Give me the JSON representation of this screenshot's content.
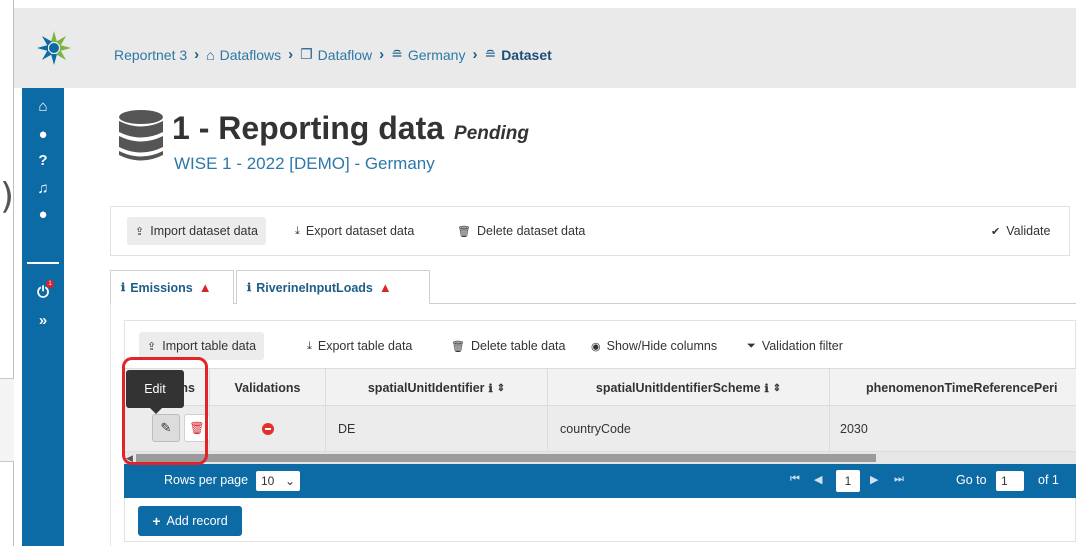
{
  "breadcrumb": {
    "items": [
      "Reportnet 3",
      "Dataflows",
      "Dataflow",
      "Germany"
    ],
    "current": "Dataset"
  },
  "sidebar": {
    "badge_count": "1"
  },
  "header": {
    "title": "1 - Reporting data",
    "status": "Pending",
    "subtitle": "WISE 1 - 2022 [DEMO] - Germany"
  },
  "dataset_toolbar": {
    "import_label": "Import dataset data",
    "export_label": "Export dataset data",
    "delete_label": "Delete dataset data",
    "validate_label": "Validate"
  },
  "tabs": [
    {
      "label": "Emissions"
    },
    {
      "label": "RiverineInputLoads"
    }
  ],
  "table_toolbar": {
    "import_label": "Import table data",
    "export_label": "Export table data",
    "delete_label": "Delete table data",
    "show_hide_label": "Show/Hide columns",
    "filter_label": "Validation filter"
  },
  "table": {
    "columns": {
      "actions": "Actions",
      "actions_visible": "ns",
      "validations": "Validations",
      "col1": "spatialUnitIdentifier",
      "col2": "spatialUnitIdentifierScheme",
      "col3": "phenomenonTimeReferencePeri"
    },
    "rows": [
      {
        "spatialUnitIdentifier": "DE",
        "spatialUnitIdentifierScheme": "countryCode",
        "phenomenonTimeReferencePeriod": "2030"
      }
    ]
  },
  "tooltip": {
    "text": "Edit"
  },
  "paginator": {
    "rows_per_page_label": "Rows per page",
    "rows_per_page_value": "10",
    "current_page": "1",
    "goto_label": "Go to",
    "goto_value": "1",
    "of_label": "of 1"
  },
  "add_record": {
    "label": "Add record"
  },
  "colors": {
    "primary": "#0c6aa4",
    "highlight": "#e3232a",
    "warning": "#d6242b"
  }
}
